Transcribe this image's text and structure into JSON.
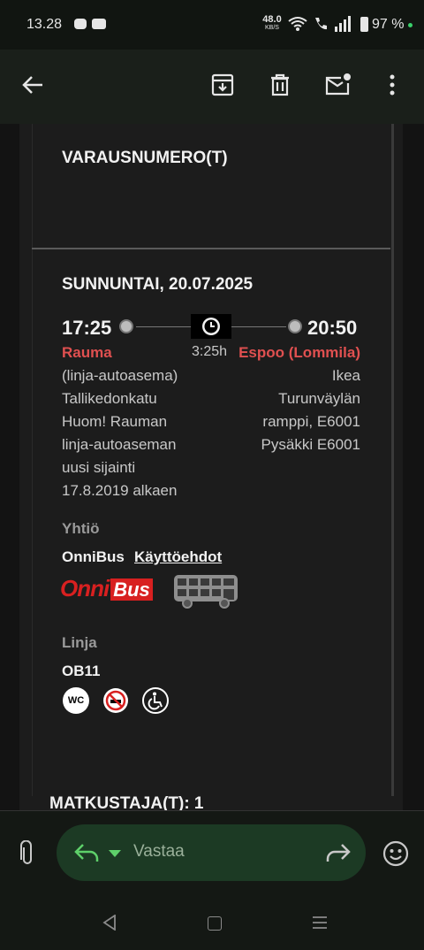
{
  "status_bar": {
    "time": "13.28",
    "speed_value": "48.0",
    "speed_unit": "KB/S",
    "battery": "97 %"
  },
  "booking": {
    "reservation_label": "VARAUSNUMERO(T)",
    "date": "SUNNUNTAI, 20.07.2025",
    "departure_time": "17:25",
    "arrival_time": "20:50",
    "duration": "3:25h",
    "departure_city": "Rauma",
    "arrival_city": "Espoo (Lommila)",
    "departure_details": [
      "(linja-autoasema)",
      "Tallikedonkatu",
      "Huom! Rauman",
      "linja-autoaseman",
      "uusi sijainti",
      "17.8.2019 alkaen"
    ],
    "arrival_details": [
      "Ikea",
      "Turunväylän",
      "ramppi, E6001",
      "Pysäkki E6001"
    ],
    "company_label": "Yhtiö",
    "company_name": "OnniBus",
    "terms_link": "Käyttöehdot",
    "logo_text_onni": "Onni",
    "logo_text_bus": "Bus",
    "line_label": "Linja",
    "line_code": "OB11",
    "wc_label": "WC",
    "passengers_label": "MATKUSTAJA(T): 1"
  },
  "reply": {
    "placeholder": "Vastaa"
  },
  "colors": {
    "accent_red": "#e05050",
    "reply_green": "#1c3a24"
  }
}
